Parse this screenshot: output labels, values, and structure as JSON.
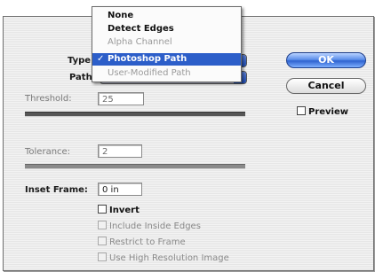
{
  "dialog": {
    "type_label": "Type:",
    "path_label": "Path:",
    "threshold_label": "Threshold:",
    "threshold_value": "25",
    "tolerance_label": "Tolerance:",
    "tolerance_value": "2",
    "inset_label": "Inset Frame:",
    "inset_value": "0 in"
  },
  "type_menu": {
    "items": [
      {
        "label": "None",
        "state": "enabled"
      },
      {
        "label": "Detect Edges",
        "state": "enabled"
      },
      {
        "label": "Alpha Channel",
        "state": "disabled"
      },
      {
        "label": "Photoshop Path",
        "state": "selected"
      },
      {
        "label": "User-Modified Path",
        "state": "disabled"
      }
    ],
    "check_glyph": "✓"
  },
  "buttons": {
    "ok": "OK",
    "cancel": "Cancel"
  },
  "options": {
    "preview": "Preview",
    "invert": "Invert",
    "include_inside_edges": "Include Inside Edges",
    "restrict_to_frame": "Restrict to Frame",
    "high_res": "Use High Resolution Image"
  },
  "colors": {
    "selection": "#2c5ec9",
    "ok_button": "#2f63d0"
  }
}
